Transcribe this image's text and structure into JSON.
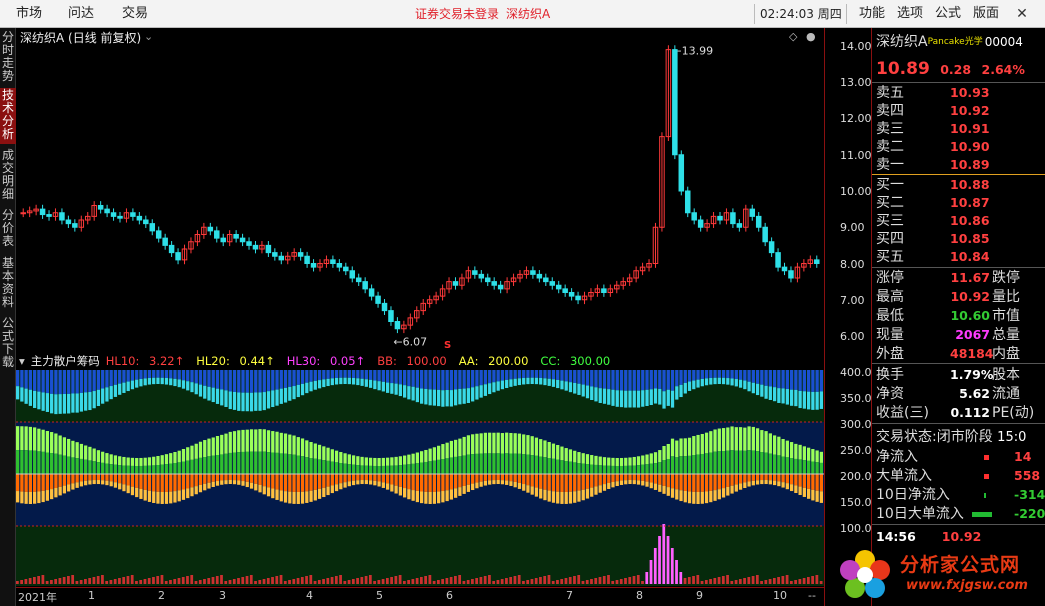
{
  "topbar": {
    "menus": [
      "市场",
      "问达",
      "交易"
    ],
    "warnings": [
      "证券交易未登录",
      "深纺织A"
    ],
    "clock": "02:24:03 周四",
    "right_menus": [
      "功能",
      "选项",
      "公式",
      "版面"
    ],
    "close": "✕"
  },
  "left_tabs": [
    "分时走势",
    "技术分析",
    "成交明细",
    "分价表",
    "基本资料",
    "公式下载"
  ],
  "chart": {
    "title": "深纺织A (日线 前复权)",
    "high_label": "13.99",
    "low_label": "6.07",
    "marker": "S"
  },
  "indicator": {
    "name": "主力散户筹码",
    "fields": [
      {
        "label": "HL10:",
        "value": "3.22↑",
        "color": "#ff4040"
      },
      {
        "label": "HL20:",
        "value": "0.44↑",
        "color": "#ffff40"
      },
      {
        "label": "HL30:",
        "value": "0.05↑",
        "color": "#ff40ff"
      },
      {
        "label": "BB:",
        "value": "100.00",
        "color": "#ff4040"
      },
      {
        "label": "AA:",
        "value": "200.00",
        "color": "#ffff40"
      },
      {
        "label": "CC:",
        "value": "300.00",
        "color": "#40ff40"
      }
    ]
  },
  "price_axis": [
    "14.00",
    "13.00",
    "12.00",
    "11.00",
    "10.00",
    "9.00",
    "8.00",
    "7.00",
    "6.00"
  ],
  "ind_axis": [
    "400.0",
    "350.0",
    "300.0",
    "250.0",
    "200.0",
    "150.0",
    "100.0"
  ],
  "time_axis": [
    "2021年",
    "1",
    "2",
    "3",
    "4",
    "5",
    "6",
    "7",
    "8",
    "9",
    "10",
    "--"
  ],
  "panel": {
    "name": "深纺织A",
    "name_tag": "Pancake光学",
    "code": "00004",
    "price": "10.89",
    "change": "0.28",
    "change_pct": "2.64%",
    "asks": [
      {
        "label": "卖五",
        "price": "10.93"
      },
      {
        "label": "卖四",
        "price": "10.92"
      },
      {
        "label": "卖三",
        "price": "10.91"
      },
      {
        "label": "卖二",
        "price": "10.90"
      },
      {
        "label": "卖一",
        "price": "10.89"
      }
    ],
    "bids": [
      {
        "label": "买一",
        "price": "10.88"
      },
      {
        "label": "买二",
        "price": "10.87"
      },
      {
        "label": "买三",
        "price": "10.86"
      },
      {
        "label": "买四",
        "price": "10.85"
      },
      {
        "label": "买五",
        "price": "10.84"
      }
    ],
    "stats": [
      {
        "label": "涨停",
        "value": "11.67",
        "color": "red",
        "right": "跌停"
      },
      {
        "label": "最高",
        "value": "10.92",
        "color": "red",
        "right": "量比"
      },
      {
        "label": "最低",
        "value": "10.60",
        "color": "green",
        "right": "市值"
      },
      {
        "label": "现量",
        "value": "2067",
        "color": "mag",
        "right": "总量"
      },
      {
        "label": "外盘",
        "value": "48184",
        "color": "red",
        "right": "内盘"
      }
    ],
    "stats2": [
      {
        "label": "换手",
        "value": "1.79%",
        "right": "股本"
      },
      {
        "label": "净资",
        "value": "5.62",
        "right": "流通"
      },
      {
        "label": "收益(三)",
        "value": "0.112",
        "right": "PE(动)"
      }
    ],
    "trade_status_label": "交易状态:",
    "trade_status": "闭市阶段",
    "trade_time": "15:0",
    "flows": [
      {
        "label": "净流入",
        "value": "14",
        "color": "red"
      },
      {
        "label": "大单流入",
        "value": "558",
        "color": "red"
      },
      {
        "label": "10日净流入",
        "value": "-314",
        "color": "green"
      },
      {
        "label": "10日大单流入",
        "value": "-220",
        "color": "green"
      }
    ],
    "tick_time": "14:56",
    "tick_price": "10.92"
  },
  "logo": {
    "text": "分析家公式网",
    "url": "www.fxjgsw.com"
  },
  "chart_data": {
    "type": "candlestick",
    "price_axis": [
      6.0,
      14.0
    ],
    "closes": [
      9.4,
      9.45,
      9.5,
      9.35,
      9.3,
      9.4,
      9.2,
      9.1,
      9.0,
      9.2,
      9.3,
      9.6,
      9.5,
      9.4,
      9.3,
      9.25,
      9.4,
      9.3,
      9.2,
      9.1,
      8.9,
      8.7,
      8.5,
      8.3,
      8.1,
      8.4,
      8.6,
      8.8,
      9.0,
      8.9,
      8.7,
      8.6,
      8.8,
      8.7,
      8.6,
      8.5,
      8.4,
      8.5,
      8.3,
      8.2,
      8.1,
      8.2,
      8.3,
      8.2,
      8.0,
      7.9,
      8.0,
      8.1,
      8.0,
      7.9,
      7.8,
      7.6,
      7.5,
      7.3,
      7.1,
      6.9,
      6.7,
      6.4,
      6.2,
      6.3,
      6.5,
      6.7,
      6.9,
      7.0,
      7.1,
      7.3,
      7.5,
      7.4,
      7.6,
      7.8,
      7.7,
      7.6,
      7.5,
      7.4,
      7.3,
      7.5,
      7.6,
      7.7,
      7.8,
      7.7,
      7.6,
      7.5,
      7.4,
      7.3,
      7.2,
      7.1,
      7.0,
      7.1,
      7.2,
      7.3,
      7.2,
      7.3,
      7.4,
      7.5,
      7.6,
      7.8,
      7.9,
      8.0,
      9.0,
      11.5,
      13.9,
      11.0,
      10.0,
      9.4,
      9.2,
      9.0,
      9.1,
      9.3,
      9.2,
      9.4,
      9.1,
      9.0,
      9.5,
      9.3,
      9.0,
      8.6,
      8.3,
      7.9,
      7.8,
      7.6,
      7.9,
      8.0,
      8.1,
      8.0
    ],
    "high_point": 13.99,
    "low_point": 6.07
  }
}
